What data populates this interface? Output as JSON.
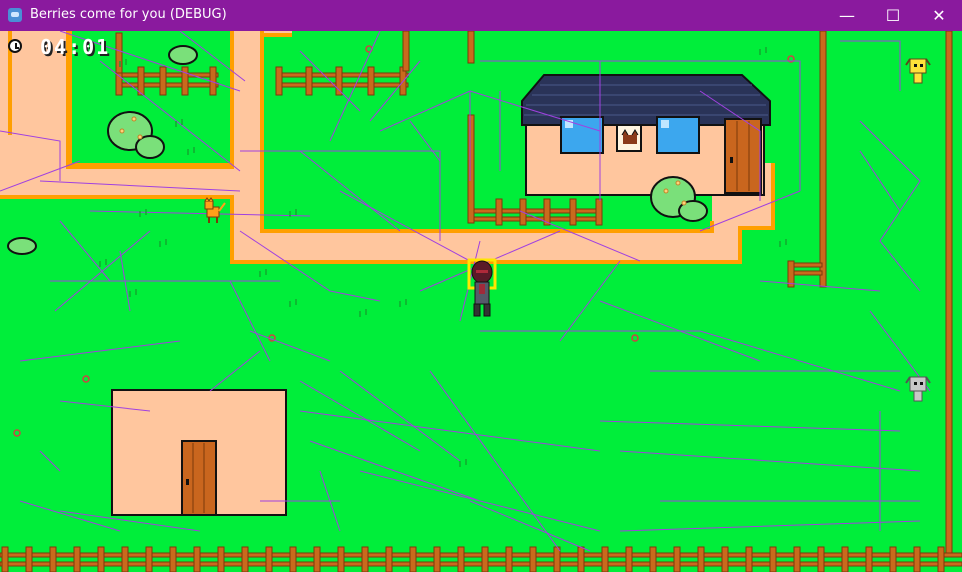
{
  "window": {
    "title": "Berries come for you (DEBUG)",
    "minimize_glyph": "—",
    "maximize_glyph": "☐",
    "close_glyph": "✕"
  },
  "hud": {
    "clock_icon": "clock-icon",
    "time": "04:01"
  },
  "scene": {
    "house": {
      "roof": "dark-navy-roof",
      "sign_icon": "cat-face-sign-icon"
    },
    "storehouse": {
      "door_icon": "wooden-door-icon"
    },
    "player": "dark-red-hooded-character",
    "npcs": [
      "orange-cat-icon",
      "yellow-creature-icon",
      "grey-creature-icon"
    ]
  },
  "colors": {
    "titlebar": "#8a1a9e",
    "grass": "#00ee3a",
    "path": "#ffc69e",
    "path_border": "#ff9f00",
    "fence": "#c96a1d",
    "debug_lines": "#a040e0",
    "roof": "#2a3358",
    "window_glass": "#3ca7ee",
    "door": "#c9661e"
  }
}
